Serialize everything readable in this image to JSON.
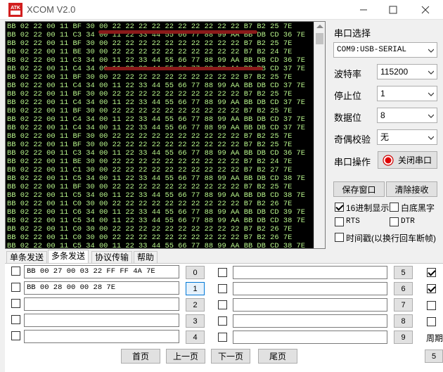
{
  "window": {
    "title": "XCOM V2.0",
    "logo_text": "ATK"
  },
  "receive": {
    "lines": [
      "BB 02 22 00 11 BF 30 00 22 22 22 22 22 22 22 22 22 22 B7 B2 25 7E",
      "BB 02 22 00 11 C3 34 00 11 22 33 44 55 66 77 88 99 AA BB DB CD 36 7E",
      "BB 02 22 00 11 BF 30 00 22 22 22 22 22 22 22 22 22 22 B7 B2 25 7E",
      "BB 02 22 00 11 BE 30 00 22 22 22 22 22 22 22 22 22 22 B7 B2 24 7E",
      "BB 02 22 00 11 C3 34 00 11 22 33 44 55 66 77 88 99 AA BB DB CD 36 7E",
      "BB 02 22 00 11 C4 34 00 11 22 33 44 55 66 77 88 99 AA BB DB CD 37 7E",
      "BB 02 22 00 11 BF 30 00 22 22 22 22 22 22 22 22 22 22 B7 B2 25 7E",
      "BB 02 22 00 11 C4 34 00 11 22 33 44 55 66 77 88 99 AA BB DB CD 37 7E",
      "BB 02 22 00 11 BF 30 00 22 22 22 22 22 22 22 22 22 22 B7 B2 25 7E",
      "BB 02 22 00 11 C4 34 00 11 22 33 44 55 66 77 88 99 AA BB DB CD 37 7E",
      "BB 02 22 00 11 BF 30 00 22 22 22 22 22 22 22 22 22 22 B7 B2 25 7E",
      "BB 02 22 00 11 C4 34 00 11 22 33 44 55 66 77 88 99 AA BB DB CD 37 7E",
      "BB 02 22 00 11 C4 34 00 11 22 33 44 55 66 77 88 99 AA BB DB CD 37 7E",
      "BB 02 22 00 11 BF 30 00 22 22 22 22 22 22 22 22 22 22 B7 B2 25 7E",
      "BB 02 22 00 11 BF 30 00 22 22 22 22 22 22 22 22 22 22 B7 B2 25 7E",
      "BB 02 22 00 11 C3 34 00 11 22 33 44 55 66 77 88 99 AA BB DB CD 36 7E",
      "BB 02 22 00 11 BE 30 00 22 22 22 22 22 22 22 22 22 22 B7 B2 24 7E",
      "BB 02 22 00 11 C1 30 00 22 22 22 22 22 22 22 22 22 22 B7 B2 27 7E",
      "BB 02 22 00 11 C5 34 00 11 22 33 44 55 66 77 88 99 AA BB DB CD 38 7E",
      "BB 02 22 00 11 BF 30 00 22 22 22 22 22 22 22 22 22 22 B7 B2 25 7E",
      "BB 02 22 00 11 C5 34 00 11 22 33 44 55 66 77 88 99 AA BB DB CD 38 7E",
      "BB 02 22 00 11 C0 30 00 22 22 22 22 22 22 22 22 22 22 B7 B2 26 7E",
      "BB 02 22 00 11 C6 34 00 11 22 33 44 55 66 77 88 99 AA BB DB CD 39 7E",
      "BB 02 22 00 11 C5 34 00 11 22 33 44 55 66 77 88 99 AA BB DB CD 38 7E",
      "BB 02 22 00 11 C0 30 00 22 22 22 22 22 22 22 22 22 22 B7 B2 26 7E",
      "BB 02 22 00 11 C0 30 00 22 22 22 22 22 22 22 22 22 22 B7 B2 26 7E",
      "BB 02 22 00 11 C5 34 00 11 22 33 44 55 66 77 88 99 AA BB DB CD 38 7E",
      "BB 02 22 00 11 C5 34 00 11 22 33 44 55 66 77 88 99 AA BB DB CD 38 7E"
    ]
  },
  "settings": {
    "port_select_label": "串口选择",
    "port_value": "COM9:USB-SERIAL",
    "baud_label": "波特率",
    "baud_value": "115200",
    "stop_label": "停止位",
    "stop_value": "1",
    "data_label": "数据位",
    "data_value": "8",
    "parity_label": "奇偶校验",
    "parity_value": "无",
    "port_op_label": "串口操作",
    "close_port_button": "关闭串口",
    "save_window_button": "保存窗口",
    "clear_receive_button": "清除接收",
    "hex_display_label": "16进制显示",
    "hex_display_checked": true,
    "white_black_label": "白底黑字",
    "white_black_checked": false,
    "rts_label": "RTS",
    "dtr_label": "DTR",
    "timestamp_label": "时间戳(以换行回车断帧)"
  },
  "tabs": [
    {
      "label": "单条发送",
      "active": false
    },
    {
      "label": "多条发送",
      "active": true
    },
    {
      "label": "协议传输",
      "active": false
    },
    {
      "label": "帮助",
      "active": false
    }
  ],
  "multi_send": {
    "left_rows": [
      {
        "text": "BB 00 27 00 03 22 FF FF 4A 7E",
        "button": "0",
        "checked": false,
        "focused": false
      },
      {
        "text": "BB 00 28 00 00 28 7E",
        "button": "1",
        "checked": false,
        "focused": true
      },
      {
        "text": "",
        "button": "2",
        "checked": false,
        "focused": false
      },
      {
        "text": "",
        "button": "3",
        "checked": false,
        "focused": false
      },
      {
        "text": "",
        "button": "4",
        "checked": false,
        "focused": false
      }
    ],
    "right_rows": [
      {
        "text": "",
        "button": "5",
        "checked": false,
        "end_checked": true
      },
      {
        "text": "",
        "button": "6",
        "checked": false,
        "end_checked": true
      },
      {
        "text": "",
        "button": "7",
        "checked": false,
        "end_checked": false
      },
      {
        "text": "",
        "button": "8",
        "checked": false,
        "end_checked": false
      },
      {
        "text": "",
        "button": "9",
        "checked": false,
        "end_checked": false
      }
    ],
    "cycle_label": "周期",
    "cut_button": "5",
    "pages": {
      "first": "首页",
      "prev": "上一页",
      "next": "下一页",
      "last": "尾页"
    }
  }
}
